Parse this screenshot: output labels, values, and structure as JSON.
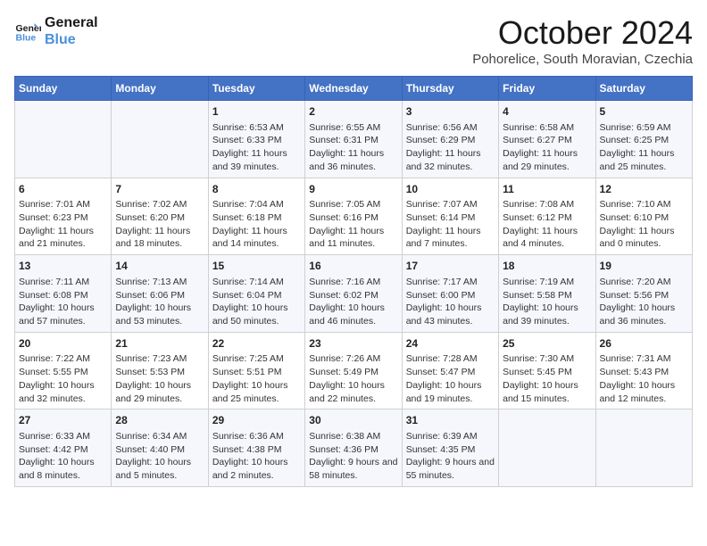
{
  "header": {
    "logo_line1": "General",
    "logo_line2": "Blue",
    "month": "October 2024",
    "location": "Pohorelice, South Moravian, Czechia"
  },
  "days_of_week": [
    "Sunday",
    "Monday",
    "Tuesday",
    "Wednesday",
    "Thursday",
    "Friday",
    "Saturday"
  ],
  "weeks": [
    [
      {
        "day": "",
        "content": ""
      },
      {
        "day": "",
        "content": ""
      },
      {
        "day": "1",
        "content": "Sunrise: 6:53 AM\nSunset: 6:33 PM\nDaylight: 11 hours and 39 minutes."
      },
      {
        "day": "2",
        "content": "Sunrise: 6:55 AM\nSunset: 6:31 PM\nDaylight: 11 hours and 36 minutes."
      },
      {
        "day": "3",
        "content": "Sunrise: 6:56 AM\nSunset: 6:29 PM\nDaylight: 11 hours and 32 minutes."
      },
      {
        "day": "4",
        "content": "Sunrise: 6:58 AM\nSunset: 6:27 PM\nDaylight: 11 hours and 29 minutes."
      },
      {
        "day": "5",
        "content": "Sunrise: 6:59 AM\nSunset: 6:25 PM\nDaylight: 11 hours and 25 minutes."
      }
    ],
    [
      {
        "day": "6",
        "content": "Sunrise: 7:01 AM\nSunset: 6:23 PM\nDaylight: 11 hours and 21 minutes."
      },
      {
        "day": "7",
        "content": "Sunrise: 7:02 AM\nSunset: 6:20 PM\nDaylight: 11 hours and 18 minutes."
      },
      {
        "day": "8",
        "content": "Sunrise: 7:04 AM\nSunset: 6:18 PM\nDaylight: 11 hours and 14 minutes."
      },
      {
        "day": "9",
        "content": "Sunrise: 7:05 AM\nSunset: 6:16 PM\nDaylight: 11 hours and 11 minutes."
      },
      {
        "day": "10",
        "content": "Sunrise: 7:07 AM\nSunset: 6:14 PM\nDaylight: 11 hours and 7 minutes."
      },
      {
        "day": "11",
        "content": "Sunrise: 7:08 AM\nSunset: 6:12 PM\nDaylight: 11 hours and 4 minutes."
      },
      {
        "day": "12",
        "content": "Sunrise: 7:10 AM\nSunset: 6:10 PM\nDaylight: 11 hours and 0 minutes."
      }
    ],
    [
      {
        "day": "13",
        "content": "Sunrise: 7:11 AM\nSunset: 6:08 PM\nDaylight: 10 hours and 57 minutes."
      },
      {
        "day": "14",
        "content": "Sunrise: 7:13 AM\nSunset: 6:06 PM\nDaylight: 10 hours and 53 minutes."
      },
      {
        "day": "15",
        "content": "Sunrise: 7:14 AM\nSunset: 6:04 PM\nDaylight: 10 hours and 50 minutes."
      },
      {
        "day": "16",
        "content": "Sunrise: 7:16 AM\nSunset: 6:02 PM\nDaylight: 10 hours and 46 minutes."
      },
      {
        "day": "17",
        "content": "Sunrise: 7:17 AM\nSunset: 6:00 PM\nDaylight: 10 hours and 43 minutes."
      },
      {
        "day": "18",
        "content": "Sunrise: 7:19 AM\nSunset: 5:58 PM\nDaylight: 10 hours and 39 minutes."
      },
      {
        "day": "19",
        "content": "Sunrise: 7:20 AM\nSunset: 5:56 PM\nDaylight: 10 hours and 36 minutes."
      }
    ],
    [
      {
        "day": "20",
        "content": "Sunrise: 7:22 AM\nSunset: 5:55 PM\nDaylight: 10 hours and 32 minutes."
      },
      {
        "day": "21",
        "content": "Sunrise: 7:23 AM\nSunset: 5:53 PM\nDaylight: 10 hours and 29 minutes."
      },
      {
        "day": "22",
        "content": "Sunrise: 7:25 AM\nSunset: 5:51 PM\nDaylight: 10 hours and 25 minutes."
      },
      {
        "day": "23",
        "content": "Sunrise: 7:26 AM\nSunset: 5:49 PM\nDaylight: 10 hours and 22 minutes."
      },
      {
        "day": "24",
        "content": "Sunrise: 7:28 AM\nSunset: 5:47 PM\nDaylight: 10 hours and 19 minutes."
      },
      {
        "day": "25",
        "content": "Sunrise: 7:30 AM\nSunset: 5:45 PM\nDaylight: 10 hours and 15 minutes."
      },
      {
        "day": "26",
        "content": "Sunrise: 7:31 AM\nSunset: 5:43 PM\nDaylight: 10 hours and 12 minutes."
      }
    ],
    [
      {
        "day": "27",
        "content": "Sunrise: 6:33 AM\nSunset: 4:42 PM\nDaylight: 10 hours and 8 minutes."
      },
      {
        "day": "28",
        "content": "Sunrise: 6:34 AM\nSunset: 4:40 PM\nDaylight: 10 hours and 5 minutes."
      },
      {
        "day": "29",
        "content": "Sunrise: 6:36 AM\nSunset: 4:38 PM\nDaylight: 10 hours and 2 minutes."
      },
      {
        "day": "30",
        "content": "Sunrise: 6:38 AM\nSunset: 4:36 PM\nDaylight: 9 hours and 58 minutes."
      },
      {
        "day": "31",
        "content": "Sunrise: 6:39 AM\nSunset: 4:35 PM\nDaylight: 9 hours and 55 minutes."
      },
      {
        "day": "",
        "content": ""
      },
      {
        "day": "",
        "content": ""
      }
    ]
  ]
}
